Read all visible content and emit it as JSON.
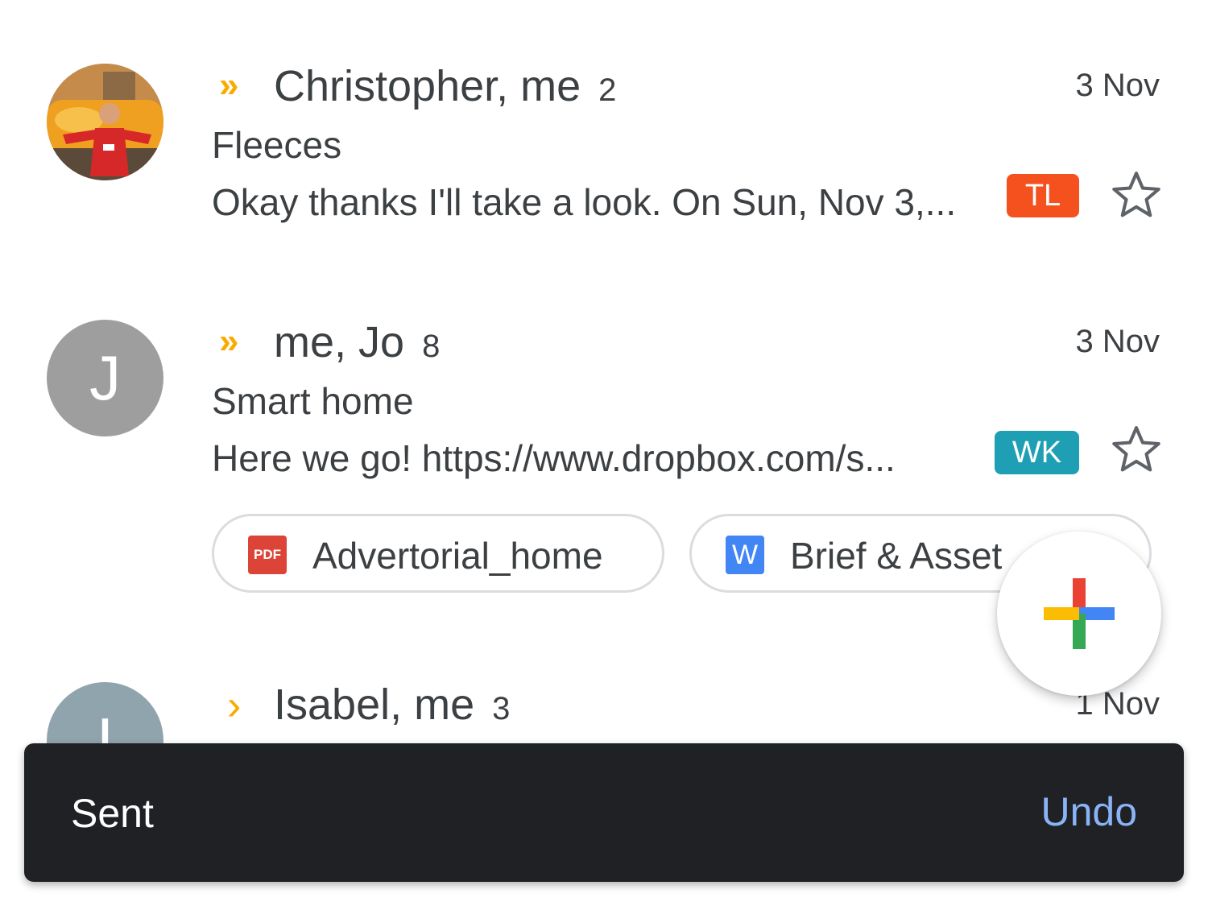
{
  "colors": {
    "importance_marker": "#f9ab00",
    "label_tl": "#f4511e",
    "label_wk": "#1e9fb4",
    "avatar_j": "#9e9e9e",
    "avatar_i": "#90a4ae",
    "pdf_icon": "#db4437",
    "word_icon": "#4285f4",
    "snackbar_bg": "#202124",
    "snackbar_action": "#8ab4f8",
    "fab_red": "#ea4335",
    "fab_blue": "#4285f4",
    "fab_green": "#34a853",
    "fab_yellow": "#fbbc04"
  },
  "threads": [
    {
      "avatar_icon": "photo-avatar-icon",
      "importance": "»",
      "sender": "Christopher, me",
      "count": "2",
      "date": "3 Nov",
      "subject": "Fleeces",
      "snippet": "Okay thanks I'll take a look. On Sun, Nov 3,...",
      "label": "TL",
      "star_icon": "star-outline-icon"
    },
    {
      "avatar_letter": "J",
      "importance": "»",
      "sender": "me, Jo",
      "count": "8",
      "date": "3 Nov",
      "subject": "Smart home",
      "snippet": "Here we go! https://www.dropbox.com/s...",
      "label": "WK",
      "star_icon": "star-outline-icon",
      "attachments": [
        {
          "icon": "pdf-icon",
          "icon_text": "PDF",
          "name": "Advertorial_home"
        },
        {
          "icon": "word-doc-icon",
          "icon_text": "W",
          "name": "Brief & Asset"
        }
      ]
    },
    {
      "avatar_letter": "I",
      "importance": "›",
      "sender": "Isabel, me",
      "count": "3",
      "date": "1 Nov"
    }
  ],
  "fab": {
    "icon": "compose-plus-icon"
  },
  "snackbar": {
    "message": "Sent",
    "action": "Undo"
  }
}
